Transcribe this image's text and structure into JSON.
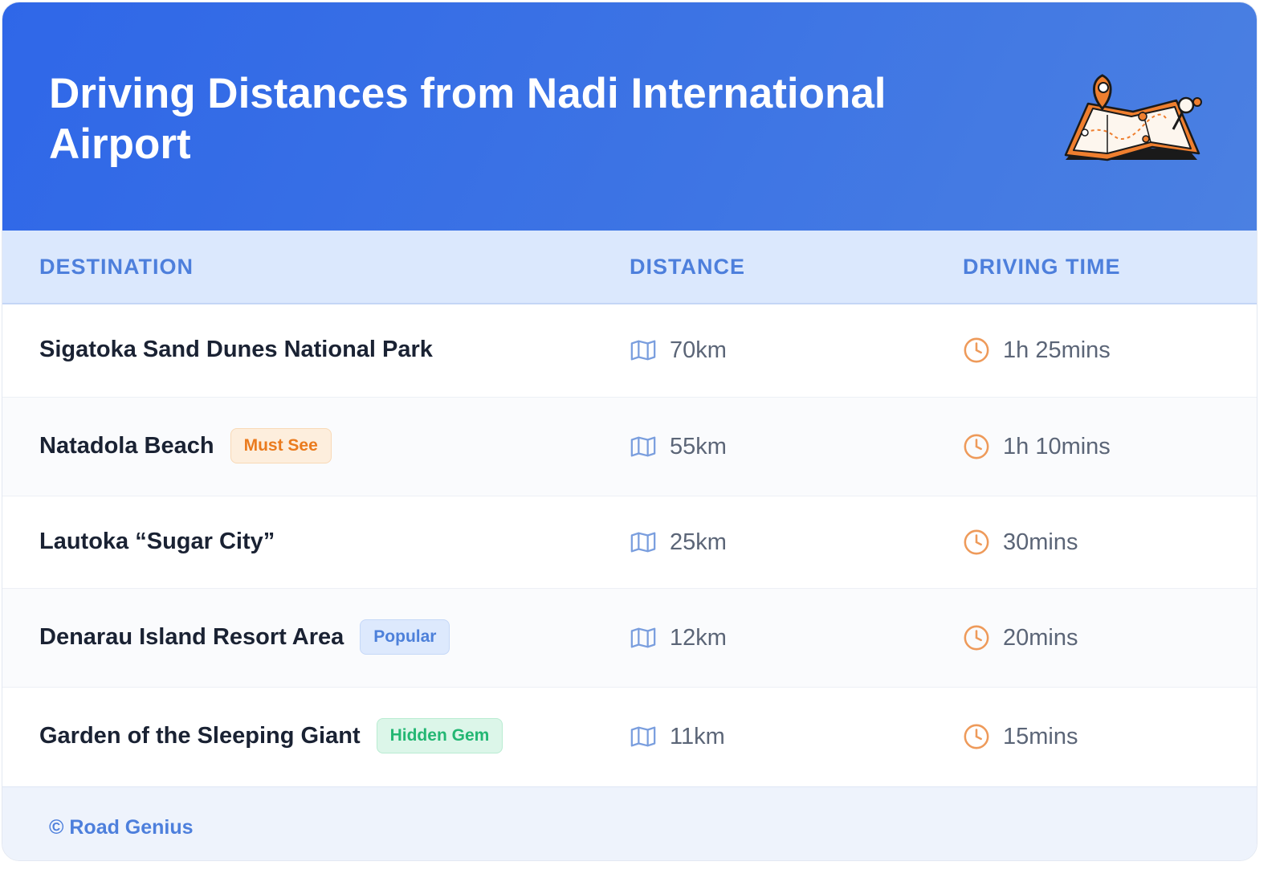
{
  "header": {
    "title": "Driving Distances from Nadi International Airport",
    "illustration": "map-with-pin-icon"
  },
  "table": {
    "columns": [
      "DESTINATION",
      "DISTANCE",
      "DRIVING TIME"
    ],
    "rows": [
      {
        "destination": "Sigatoka Sand Dunes National Park",
        "badge": "",
        "distance": "70km",
        "time": "1h 25mins"
      },
      {
        "destination": "Natadola Beach",
        "badge": "Must See",
        "badge_color": "#ea7b1e",
        "distance": "55km",
        "time": "1h 10mins"
      },
      {
        "destination": "Lautoka “Sugar City”",
        "badge": "",
        "distance": "25km",
        "time": "30mins"
      },
      {
        "destination": "Denarau Island Resort Area",
        "badge": "Popular",
        "badge_color": "#4d80da",
        "distance": "12km",
        "time": "20mins"
      },
      {
        "destination": "Garden of the Sleeping Giant",
        "badge": "Hidden Gem",
        "badge_color": "#23b773",
        "distance": "11km",
        "time": "15mins"
      }
    ],
    "distance_icon": "map-icon",
    "time_icon": "clock-icon"
  },
  "footer": {
    "credit": "© Road Genius"
  },
  "colors": {
    "header": "#2f67e8",
    "accent": "#4d7fdc",
    "clock": "#ee9a5a"
  }
}
